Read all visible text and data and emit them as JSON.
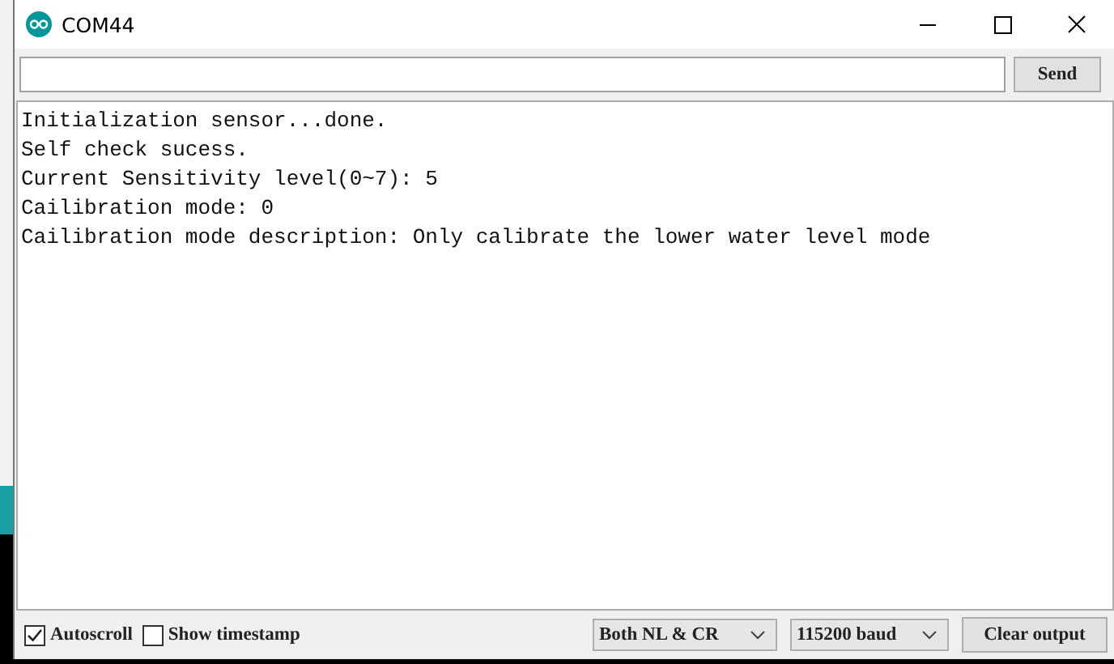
{
  "window": {
    "title": "COM44"
  },
  "send_button": "Send",
  "output_lines": [
    "Initialization sensor...done.",
    "Self check sucess.",
    "Current Sensitivity level(0~7): 5",
    "Cailibration mode: 0",
    "Cailibration mode description: Only calibrate the lower water level mode"
  ],
  "footer": {
    "checkboxes": [
      {
        "label": "Autoscroll",
        "checked": true
      },
      {
        "label": "Show timestamp",
        "checked": false
      }
    ],
    "line_ending": "Both NL & CR",
    "baud": "115200 baud",
    "clear_button": "Clear output"
  }
}
